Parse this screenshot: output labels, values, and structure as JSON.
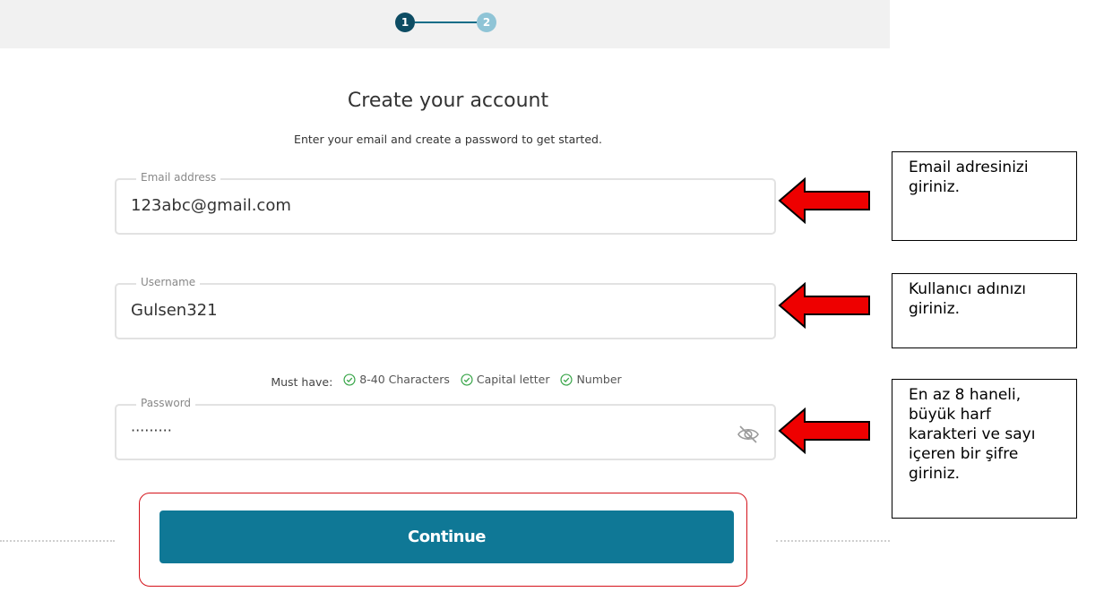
{
  "stepper": {
    "step1": "1",
    "step2": "2",
    "active_color": "#0d4c63",
    "inactive_color": "#8fc4d6"
  },
  "header": {
    "title": "Create your account",
    "subtitle": "Enter your email and create a password to get started."
  },
  "email": {
    "label": "Email address",
    "value": "123abc@gmail.com"
  },
  "username": {
    "label": "Username",
    "value": "Gulsen321"
  },
  "requirements": {
    "label": "Must have:",
    "items": [
      "8-40 Characters",
      "Capital letter",
      "Number"
    ],
    "check_color": "#3aa64a"
  },
  "password": {
    "label": "Password",
    "value": "·········",
    "toggle_icon": "eye-slash-icon"
  },
  "continue": {
    "label": "Continue",
    "color": "#0f7896"
  },
  "annotations": {
    "note1": "Email adresinizi giriniz.",
    "note2": "Kullanıcı adınızı giriniz.",
    "note3": "En az 8 haneli, büyük harf karakteri ve sayı içeren bir şifre giriniz.",
    "arrow_color": "#ee0000"
  }
}
